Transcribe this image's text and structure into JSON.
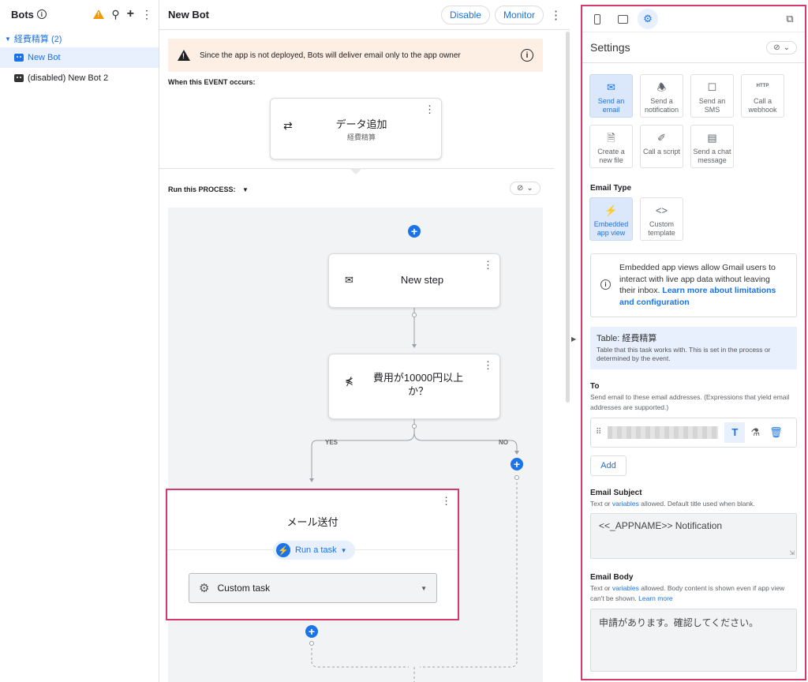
{
  "sidebar": {
    "title": "Bots",
    "group": {
      "label": "経費精算 (2)"
    },
    "items": [
      {
        "label": "New Bot"
      },
      {
        "label": "(disabled) New Bot 2"
      }
    ]
  },
  "editor": {
    "title": "New Bot",
    "disable_label": "Disable",
    "monitor_label": "Monitor",
    "warning": "Since the app is not deployed, Bots will deliver email only to the app owner",
    "event_label": "When this EVENT occurs:",
    "event": {
      "title": "データ追加",
      "subtitle": "経費精算"
    },
    "process_label": "Run this PROCESS:",
    "steps": {
      "new_step": "New step",
      "condition": "費用が10000円以上か？",
      "yes": "YES",
      "no": "NO",
      "task_title": "メール送付",
      "run_task": "Run a task",
      "custom_task": "Custom task"
    }
  },
  "settings": {
    "title": "Settings",
    "actions": [
      {
        "label": "Send an email",
        "icon": "mail-icon",
        "selected": true
      },
      {
        "label": "Send a notification",
        "icon": "bell-icon",
        "selected": false
      },
      {
        "label": "Send an SMS",
        "icon": "sms-icon",
        "selected": false
      },
      {
        "label": "Call a webhook",
        "icon": "http-icon",
        "icon_text": "HTTP",
        "selected": false
      },
      {
        "label": "Create a new file",
        "icon": "file-icon",
        "selected": false
      },
      {
        "label": "Call a script",
        "icon": "script-icon",
        "selected": false
      },
      {
        "label": "Send a chat message",
        "icon": "chat-icon",
        "selected": false
      }
    ],
    "email_type": {
      "label": "Email Type",
      "options": [
        {
          "label": "Embedded app view",
          "selected": true
        },
        {
          "label": "Custom template",
          "selected": false
        }
      ]
    },
    "info": {
      "text": "Embedded app views allow Gmail users to interact with live app data without leaving their inbox.",
      "link": "Learn more about limitations and configuration"
    },
    "table": {
      "prefix": "Table: ",
      "name": "経費精算",
      "description": "Table that this task works with. This is set in the process or determined by the event."
    },
    "to": {
      "label": "To",
      "help": "Send email to these email addresses. (Expressions that yield email addresses are supported.)",
      "add_label": "Add"
    },
    "subject": {
      "label": "Email Subject",
      "help_prefix": "Text or ",
      "help_link": "variables",
      "help_suffix": " allowed. Default title used when blank.",
      "value": "<<_APPNAME>> Notification"
    },
    "body": {
      "label": "Email Body",
      "help_prefix": "Text or ",
      "help_link": "variables",
      "help_suffix": " allowed. Body content is shown even if app view can't be shown. ",
      "help_link2": "Learn more",
      "value": "申請があります。確認してください。"
    }
  },
  "colors": {
    "accent": "#1a73e8",
    "highlight_border": "#d63a6a",
    "warning_bg": "#fdefe3"
  }
}
